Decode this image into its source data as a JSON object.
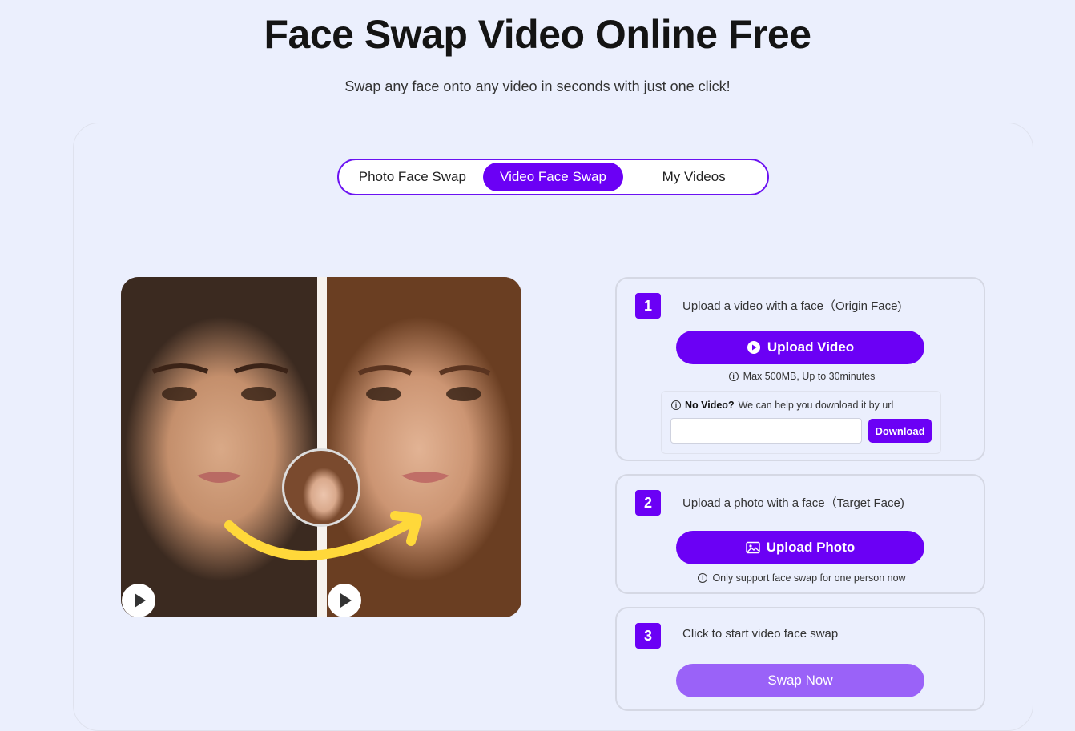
{
  "header": {
    "title": "Face Swap Video Online Free",
    "subtitle": "Swap any face onto any video in seconds with just one click!"
  },
  "tabs": [
    {
      "label": "Photo Face Swap",
      "active": false
    },
    {
      "label": "Video Face Swap",
      "active": true
    },
    {
      "label": "My Videos",
      "active": false
    }
  ],
  "steps": {
    "step1": {
      "number": "1",
      "text": "Upload a video with a face（Origin Face)",
      "button": "Upload Video",
      "note": "Max 500MB, Up to 30minutes",
      "url_help_bold": "No Video?",
      "url_help": "We can help you download it by url",
      "url_input_value": "",
      "download_button": "Download"
    },
    "step2": {
      "number": "2",
      "text": "Upload a photo with a face（Target Face)",
      "button": "Upload Photo",
      "note": "Only support face swap for one person now"
    },
    "step3": {
      "number": "3",
      "text": "Click to start video face swap",
      "button": "Swap Now"
    }
  },
  "colors": {
    "accent": "#6b00f5",
    "accent_disabled": "#9a62f8",
    "background": "#ebeffd"
  },
  "icons": {
    "upload_video": "play-circle-icon",
    "upload_photo": "image-icon",
    "info": "info-icon",
    "play": "play-icon"
  }
}
